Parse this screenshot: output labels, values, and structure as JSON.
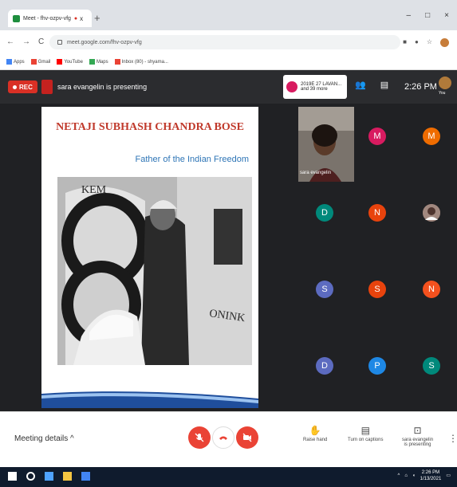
{
  "browser": {
    "tab_title": "Meet - fhv-ozpv-vfg",
    "rec_indicator": "●",
    "close_tab": "x",
    "new_tab": "+",
    "win_min": "–",
    "win_max": "□",
    "win_close": "×",
    "back": "←",
    "forward": "→",
    "reload": "C",
    "url": "meet.google.com/fhv-ozpv-vfg",
    "bookmarks": [
      {
        "label": "Apps",
        "color": "#4285f4"
      },
      {
        "label": "Gmail",
        "color": "#ea4335"
      },
      {
        "label": "YouTube",
        "color": "#ff0000"
      },
      {
        "label": "Maps",
        "color": "#34a853"
      },
      {
        "label": "Inbox (80) - shyama...",
        "color": "#ea4335"
      }
    ]
  },
  "meet": {
    "rec_label": "REC",
    "presenting_text": "sara evangelin is presenting",
    "participants_box": {
      "line1": "2019E 27 LAVAN...",
      "line2": "and 39 more"
    },
    "time": "2:26 PM",
    "you_label": "You",
    "slide": {
      "title": "NETAJI SUBHASH CHANDRA BOSE",
      "subtitle": "Father of the Indian Freedom",
      "photo_text": "KEM",
      "photo_text2": "ONINK"
    },
    "self_caption": "sara evangelin",
    "tiles": [
      {
        "letter": "M",
        "color": "#d81b60"
      },
      {
        "letter": "M",
        "color": "#ef6c00"
      },
      {
        "letter": "D",
        "color": "#00897b"
      },
      {
        "letter": "N",
        "color": "#e8430d"
      },
      {
        "letter": "",
        "color": "#8d6e63"
      },
      {
        "letter": "S",
        "color": "#5c6bc0"
      },
      {
        "letter": "S",
        "color": "#e8430d"
      },
      {
        "letter": "N",
        "color": "#f4511e"
      },
      {
        "letter": "D",
        "color": "#5c6bc0"
      },
      {
        "letter": "P",
        "color": "#1e88e5"
      },
      {
        "letter": "S",
        "color": "#00897b"
      }
    ]
  },
  "bottom": {
    "meeting_details": "Meeting details",
    "chevron": "^",
    "raise_hand": "Raise hand",
    "captions": "Turn on captions",
    "presenting_line1": "sara evangelin",
    "presenting_line2": "is presenting"
  },
  "taskbar": {
    "time": "2:26 PM",
    "date": "1/13/2021"
  }
}
